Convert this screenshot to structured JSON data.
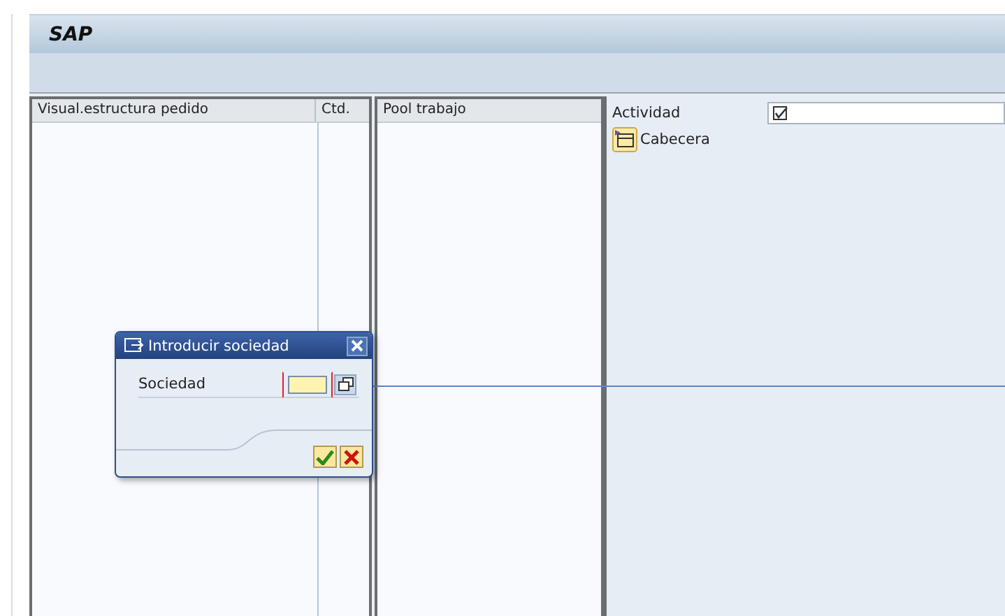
{
  "window": {
    "title": "SAP"
  },
  "tree_panel": {
    "columns": [
      "Visual.estructura pedido",
      "Ctd."
    ]
  },
  "pool_panel": {
    "columns": [
      "Pool trabajo"
    ]
  },
  "detail": {
    "activity_label": "Actividad",
    "activity_checked": true,
    "header_button": "Cabecera"
  },
  "dialog": {
    "title": "Introducir sociedad",
    "field_label": "Sociedad",
    "required": true
  }
}
